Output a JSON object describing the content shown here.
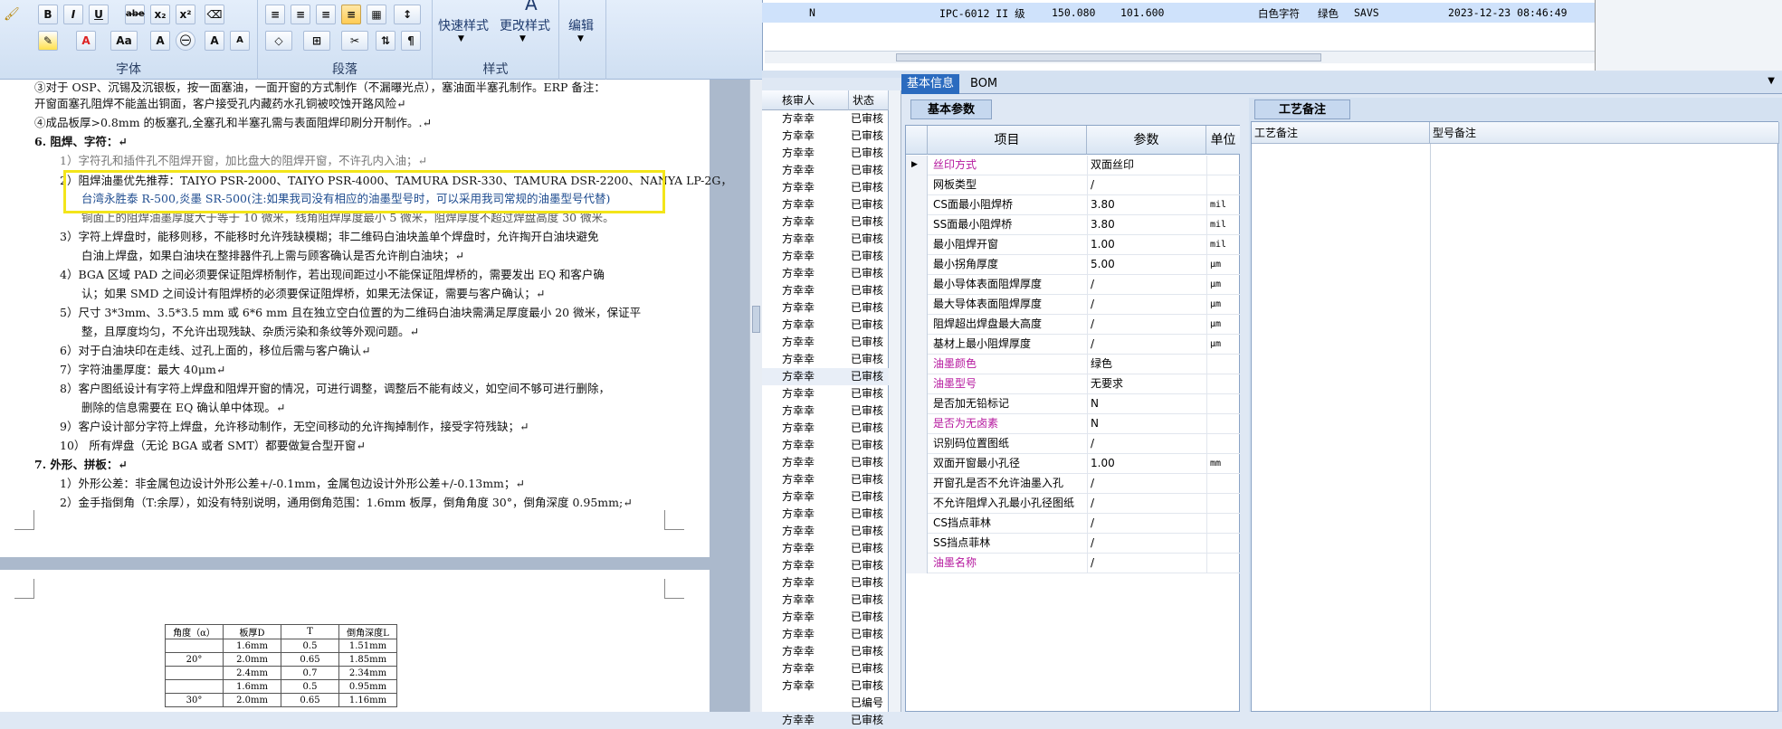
{
  "ribbon": {
    "font_group_label": "字体",
    "paragraph_group_label": "段落",
    "style_group_label": "样式",
    "edit_group_label": "编辑",
    "quick_style_label": "快速样式",
    "change_style_label": "更改样式",
    "font_buttons": [
      "B",
      "I",
      "U",
      "abe",
      "x₂",
      "x²",
      "A",
      "Aa",
      "A",
      "A",
      "A"
    ],
    "paragraph_buttons": [
      "≡",
      "≡",
      "≡",
      "≡",
      "▦",
      "↕",
      "◇",
      "⊞",
      "✂",
      "⇅",
      "¶"
    ]
  },
  "document": {
    "lines": [
      "③对于 OSP、沉锡及沉银板，按一面塞油，一面开窗的方式制作（不漏曝光点），塞油面半塞孔制作。ERP 备注：",
      "开窗面塞孔阻焊不能盖出铜面，客户接受孔内藏药水孔铜被咬蚀开路风险↵",
      "④成品板厚>0.8mm 的板塞孔,全塞孔和半塞孔需与表面阻焊印刷分开制作。.↵",
      "6.  阻焊、字符：↵",
      "1）字符孔和插件孔不阻焊开窗，加比盘大的阻焊开窗，不许孔内入油；↵",
      "2）阻焊油墨优先推荐：TAIYO PSR-2000、TAIYO PSR-4000、TAMURA  DSR-330、TAMURA DSR-2200、NANYA LP-2G，",
      "台湾永胜泰 R-500,炎墨 SR-500(注:如果我司没有相应的油墨型号时，可以采用我司常规的油墨型号代替)",
      "铜面上的阻焊油墨厚度大于等于 10 微米，线角阻焊厚度最小 5 微米，阻焊厚度不超过焊盘高度 30 微米。",
      "3）字符上焊盘时，能移则移，不能移时允许残缺模糊；非二维码白油块盖单个焊盘时，允许掏开白油块避免",
      "白油上焊盘，如果白油块在整排器件孔上需与顾客确认是否允许削白油块；↵",
      "4）BGA 区域 PAD 之间必须要保证阻焊桥制作，若出现间距过小不能保证阻焊桥的，需要发出 EQ 和客户确",
      "认；如果 SMD 之间设计有阻焊桥的必须要保证阻焊桥，如果无法保证，需要与客户确认；↵",
      "5）尺寸 3*3mm、3.5*3.5 mm 或 6*6 mm 且在独立空白位置的为二维码白油块需满足厚度最小 20 微米，保证平",
      "整，且厚度均匀，不允许出现残缺、杂质污染和条纹等外观问题。↵",
      "6）对于白油块印在走线、过孔上面的，移位后需与客户确认↵",
      "7）字符油墨厚度：最大 40μm↵",
      "8）客户图纸设计有字符上焊盘和阻焊开窗的情况，可进行调整，调整后不能有歧义，如空间不够可进行删除，",
      "删除的信息需要在 EQ 确认单中体现。↵",
      "9）客户设计部分字符上焊盘，允许移动制作，无空间移动的允许掏掉制作，接受字符残缺；↵",
      "10）     所有焊盘（无论 BGA 或者 SMT）都要做复合型开窗↵",
      "7.  外形、拼板：↵",
      "1）外形公差：非金属包边设计外形公差+/-0.1mm，金属包边设计外形公差+/-0.13mm；↵",
      "2）金手指倒角（T:余厚），如没有特别说明，通用倒角范围：1.6mm 板厚，倒角角度 30°，倒角深度 0.95mm;↵"
    ],
    "table": {
      "headers": [
        "角度（α）",
        "板厚D",
        "T",
        "倒角深度L"
      ],
      "rows": [
        [
          "",
          "1.6mm",
          "0.5",
          "1.51mm"
        ],
        [
          "20°",
          "2.0mm",
          "0.65",
          "1.85mm"
        ],
        [
          "",
          "2.4mm",
          "0.7",
          "2.34mm"
        ],
        [
          "",
          "1.6mm",
          "0.5",
          "0.95mm"
        ],
        [
          "30°",
          "2.0mm",
          "0.65",
          "1.16mm"
        ]
      ]
    }
  },
  "top_grid": {
    "row": [
      "N",
      "IPC-6012 II 级",
      "150.080",
      "101.600",
      "白色字符",
      "绿色",
      "SAVS",
      "2023-12-23 08:46:49"
    ]
  },
  "approver_list": {
    "headers": [
      "核审人",
      "状态"
    ],
    "rows": [
      [
        "方幸幸",
        "已审核"
      ],
      [
        "方幸幸",
        "已审核"
      ],
      [
        "方幸幸",
        "已审核"
      ],
      [
        "方幸幸",
        "已审核"
      ],
      [
        "方幸幸",
        "已审核"
      ],
      [
        "方幸幸",
        "已审核"
      ],
      [
        "方幸幸",
        "已审核"
      ],
      [
        "方幸幸",
        "已审核"
      ],
      [
        "方幸幸",
        "已审核"
      ],
      [
        "方幸幸",
        "已审核"
      ],
      [
        "方幸幸",
        "已审核"
      ],
      [
        "方幸幸",
        "已审核"
      ],
      [
        "方幸幸",
        "已审核"
      ],
      [
        "方幸幸",
        "已审核"
      ],
      [
        "方幸幸",
        "已审核"
      ],
      [
        "方幸幸",
        "已审核"
      ],
      [
        "方幸幸",
        "已审核"
      ],
      [
        "方幸幸",
        "已审核"
      ],
      [
        "方幸幸",
        "已审核"
      ],
      [
        "方幸幸",
        "已审核"
      ],
      [
        "方幸幸",
        "已审核"
      ],
      [
        "方幸幸",
        "已审核"
      ],
      [
        "方幸幸",
        "已审核"
      ],
      [
        "方幸幸",
        "已审核"
      ],
      [
        "方幸幸",
        "已审核"
      ],
      [
        "方幸幸",
        "已审核"
      ],
      [
        "方幸幸",
        "已审核"
      ],
      [
        "方幸幸",
        "已审核"
      ],
      [
        "方幸幸",
        "已审核"
      ],
      [
        "方幸幸",
        "已审核"
      ],
      [
        "方幸幸",
        "已审核"
      ],
      [
        "方幸幸",
        "已审核"
      ],
      [
        "方幸幸",
        "已审核"
      ],
      [
        "方幸幸",
        "已审核"
      ],
      [
        "",
        "已编号"
      ],
      [
        "方幸幸",
        "已审核"
      ]
    ]
  },
  "base_info": {
    "tab_active": "基本信息",
    "tab_other": "BOM",
    "subtab": "基本参数",
    "notes_tab": "工艺备注",
    "grid_headers": [
      "项目",
      "参数",
      "单位"
    ],
    "rows": [
      {
        "item": "丝印方式",
        "value": "双面丝印",
        "unit": "",
        "hl": true
      },
      {
        "item": "网板类型",
        "value": "/",
        "unit": "",
        "hl": false
      },
      {
        "item": "CS面最小阻焊桥",
        "value": "3.80",
        "unit": "mil",
        "hl": false
      },
      {
        "item": "SS面最小阻焊桥",
        "value": "3.80",
        "unit": "mil",
        "hl": false
      },
      {
        "item": "最小阻焊开窗",
        "value": "1.00",
        "unit": "mil",
        "hl": false
      },
      {
        "item": "最小拐角厚度",
        "value": "5.00",
        "unit": "μm",
        "hl": false
      },
      {
        "item": "最小导体表面阻焊厚度",
        "value": "/",
        "unit": "μm",
        "hl": false
      },
      {
        "item": "最大导体表面阻焊厚度",
        "value": "/",
        "unit": "μm",
        "hl": false
      },
      {
        "item": "阻焊超出焊盘最大高度",
        "value": "/",
        "unit": "μm",
        "hl": false
      },
      {
        "item": "基材上最小阻焊厚度",
        "value": "/",
        "unit": "μm",
        "hl": false
      },
      {
        "item": "油墨颜色",
        "value": "绿色",
        "unit": "",
        "hl": true
      },
      {
        "item": "油墨型号",
        "value": "无要求",
        "unit": "",
        "hl": true
      },
      {
        "item": "是否加无铅标记",
        "value": "N",
        "unit": "",
        "hl": false
      },
      {
        "item": "是否为无卤素",
        "value": "N",
        "unit": "",
        "hl": true
      },
      {
        "item": "识别码位置图纸",
        "value": "/",
        "unit": "",
        "hl": false
      },
      {
        "item": "双面开窗最小孔径",
        "value": "1.00",
        "unit": "mm",
        "hl": false
      },
      {
        "item": "开窗孔是否不允许油墨入孔",
        "value": "/",
        "unit": "",
        "hl": false
      },
      {
        "item": "不允许阻焊入孔最小孔径图纸",
        "value": "/",
        "unit": "",
        "hl": false
      },
      {
        "item": "CS挡点菲林",
        "value": "/",
        "unit": "",
        "hl": false
      },
      {
        "item": "SS挡点菲林",
        "value": "/",
        "unit": "",
        "hl": false
      },
      {
        "item": "油墨名称",
        "value": "/",
        "unit": "",
        "hl": true
      }
    ],
    "notes_headers": [
      "工艺备注",
      "型号备注"
    ]
  },
  "colors": {
    "accent": "#2b6bbf",
    "highlight_box": "#f3e51a",
    "magenta_text": "#b5179e"
  }
}
